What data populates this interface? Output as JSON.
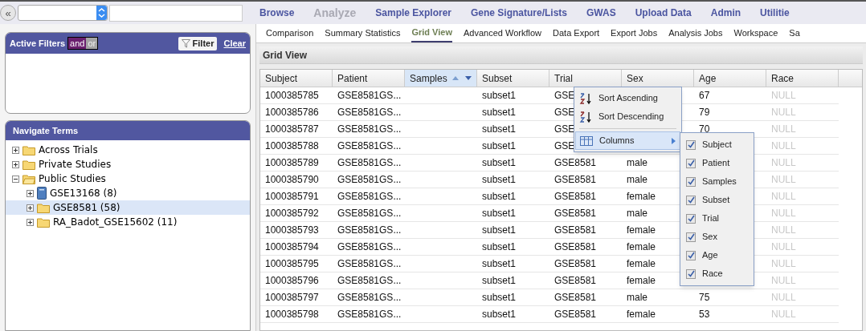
{
  "toolbar": {
    "collapse": "«"
  },
  "nav": [
    {
      "label": "Browse",
      "disabled": false
    },
    {
      "label": "Analyze",
      "disabled": true
    },
    {
      "label": "Sample Explorer",
      "disabled": false
    },
    {
      "label": "Gene Signature/Lists",
      "disabled": false
    },
    {
      "label": "GWAS",
      "disabled": false
    },
    {
      "label": "Upload Data",
      "disabled": false
    },
    {
      "label": "Admin",
      "disabled": false
    },
    {
      "label": "Utilitie",
      "disabled": false
    }
  ],
  "filters": {
    "title": "Active Filters",
    "operators": [
      {
        "label": "and",
        "selected": true
      },
      {
        "label": "or",
        "selected": false
      }
    ],
    "filter_button": "Filter",
    "clear_link": "Clear"
  },
  "navigate": {
    "title": "Navigate Terms",
    "tree": [
      {
        "label": "Across Trials",
        "kind": "folder",
        "expanded": false,
        "selected": false
      },
      {
        "label": "Private Studies",
        "kind": "folder",
        "expanded": false,
        "selected": false
      },
      {
        "label": "Public Studies",
        "kind": "folder",
        "expanded": true,
        "selected": false,
        "children": [
          {
            "label": "GSE13168 (8)",
            "kind": "study",
            "expanded": false,
            "selected": false
          },
          {
            "label": "GSE8581 (58)",
            "kind": "folder",
            "expanded": false,
            "selected": true
          },
          {
            "label": "RA_Badot_GSE15602 (11)",
            "kind": "folder",
            "expanded": false,
            "selected": false
          }
        ]
      }
    ]
  },
  "tabs": [
    {
      "label": "Comparison",
      "selected": false
    },
    {
      "label": "Summary Statistics",
      "selected": false
    },
    {
      "label": "Grid View",
      "selected": true
    },
    {
      "label": "Advanced Workflow",
      "selected": false
    },
    {
      "label": "Data Export",
      "selected": false
    },
    {
      "label": "Export Jobs",
      "selected": false
    },
    {
      "label": "Analysis Jobs",
      "selected": false
    },
    {
      "label": "Workspace",
      "selected": false
    },
    {
      "label": "Sa",
      "selected": false
    }
  ],
  "grid": {
    "title": "Grid View",
    "columns": [
      {
        "label": "Subject",
        "selected": false,
        "muted": false
      },
      {
        "label": "Patient",
        "selected": false,
        "muted": false
      },
      {
        "label": "Samples",
        "selected": true
      },
      {
        "label": "Subset",
        "selected": false,
        "muted": false
      },
      {
        "label": "Trial",
        "selected": false,
        "muted": false
      },
      {
        "label": "Sex",
        "selected": false,
        "muted": false
      },
      {
        "label": "Age",
        "selected": false,
        "muted": false
      },
      {
        "label": "Race",
        "selected": false,
        "muted": true
      }
    ],
    "rows": [
      [
        "1000385785",
        "GSE8581GS...",
        null,
        "subset1",
        "GSE",
        null,
        "67",
        "NULL"
      ],
      [
        "1000385786",
        "GSE8581GS...",
        null,
        "subset1",
        "GSE",
        null,
        "79",
        "NULL"
      ],
      [
        "1000385787",
        "GSE8581GS...",
        null,
        "subset1",
        "GSE",
        null,
        "70",
        "NULL"
      ],
      [
        "1000385788",
        "GSE8581GS...",
        null,
        "subset1",
        "GSE",
        null,
        null,
        "NULL"
      ],
      [
        "1000385789",
        "GSE8581GS...",
        null,
        "subset1",
        "GSE8581",
        "male",
        null,
        "NULL"
      ],
      [
        "1000385790",
        "GSE8581GS...",
        null,
        "subset1",
        "GSE8581",
        "male",
        null,
        "NULL"
      ],
      [
        "1000385791",
        "GSE8581GS...",
        null,
        "subset1",
        "GSE8581",
        "female",
        null,
        "NULL"
      ],
      [
        "1000385792",
        "GSE8581GS...",
        null,
        "subset1",
        "GSE8581",
        "male",
        null,
        "NULL"
      ],
      [
        "1000385793",
        "GSE8581GS...",
        null,
        "subset1",
        "GSE8581",
        "female",
        null,
        "NULL"
      ],
      [
        "1000385794",
        "GSE8581GS...",
        null,
        "subset1",
        "GSE8581",
        "female",
        null,
        "NULL"
      ],
      [
        "1000385795",
        "GSE8581GS...",
        null,
        "subset1",
        "GSE8581",
        "female",
        null,
        "NULL"
      ],
      [
        "1000385796",
        "GSE8581GS...",
        null,
        "subset1",
        "GSE8581",
        "female",
        null,
        "NULL"
      ],
      [
        "1000385797",
        "GSE8581GS...",
        null,
        "subset1",
        "GSE8581",
        "male",
        "75",
        "NULL"
      ],
      [
        "1000385798",
        "GSE8581GS...",
        null,
        "subset1",
        "GSE8581",
        "female",
        "53",
        "NULL"
      ]
    ],
    "menu": {
      "items": [
        {
          "kind": "sort-asc",
          "label": "Sort Ascending",
          "highlighted": false
        },
        {
          "kind": "sort-desc",
          "label": "Sort Descending",
          "highlighted": false
        },
        {
          "kind": "columns",
          "label": "Columns",
          "highlighted": true
        }
      ],
      "columns_submenu": [
        {
          "label": "Subject",
          "checked": true
        },
        {
          "label": "Patient",
          "checked": true
        },
        {
          "label": "Samples",
          "checked": true
        },
        {
          "label": "Subset",
          "checked": true
        },
        {
          "label": "Trial",
          "checked": true
        },
        {
          "label": "Sex",
          "checked": true
        },
        {
          "label": "Age",
          "checked": true
        },
        {
          "label": "Race",
          "checked": true
        }
      ]
    }
  }
}
